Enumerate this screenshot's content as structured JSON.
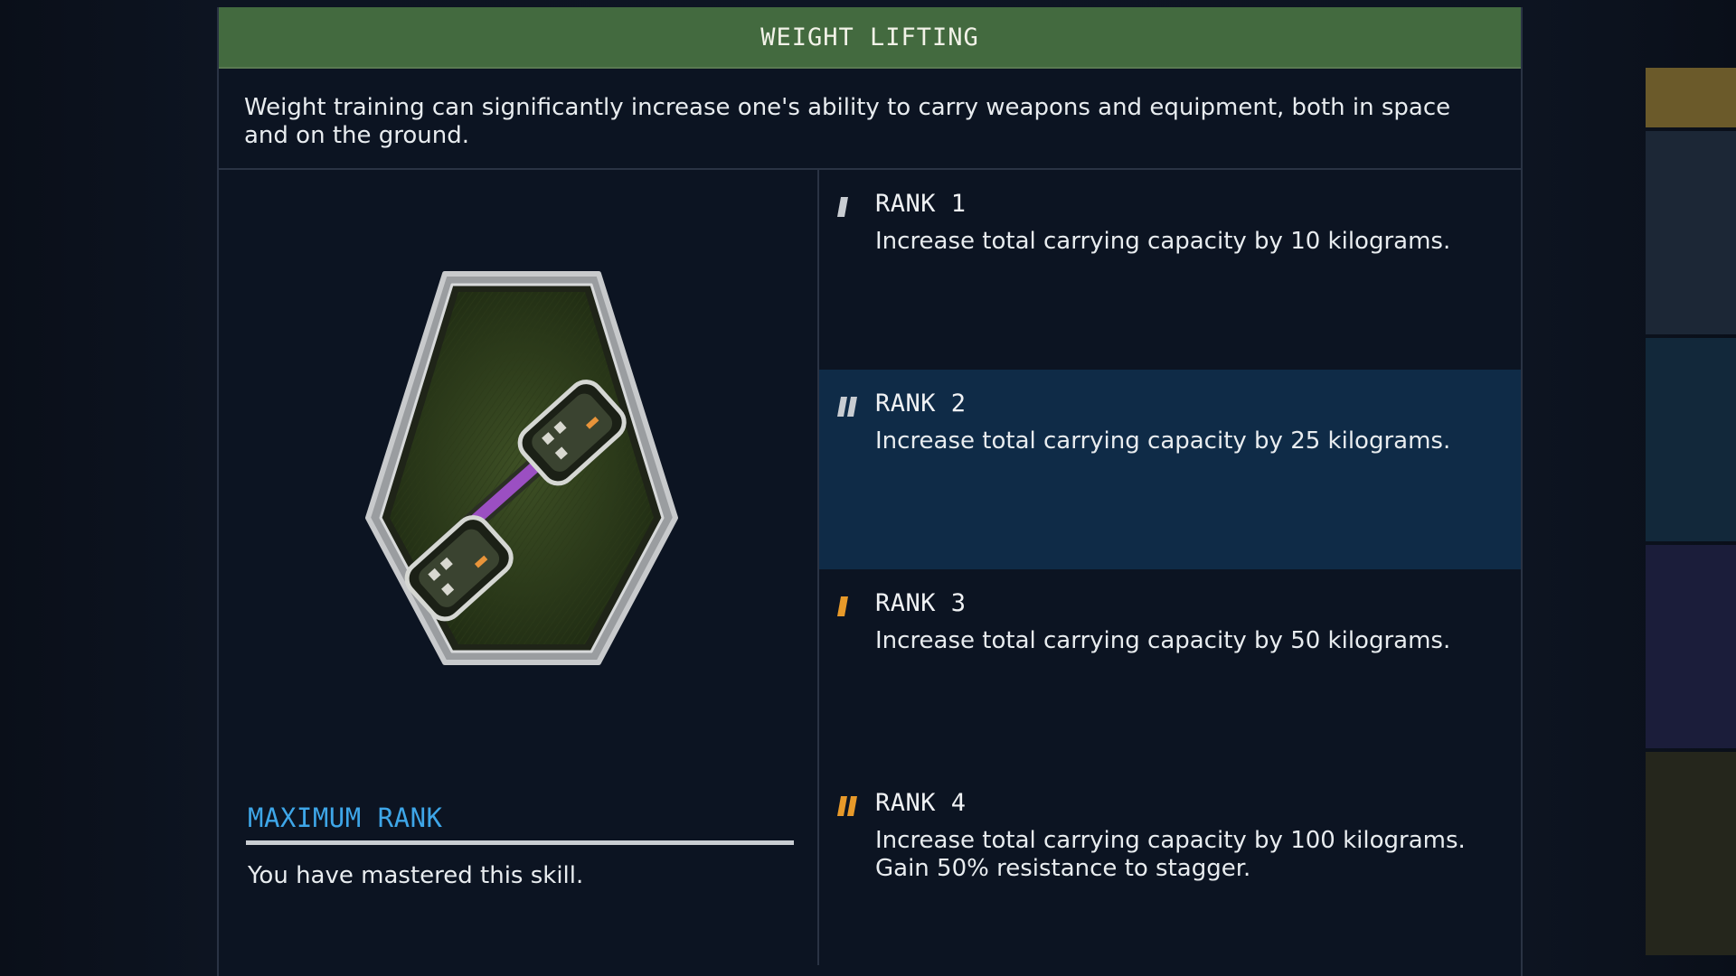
{
  "skill": {
    "title": "WEIGHT LIFTING",
    "description": "Weight training can significantly increase one's ability to carry weapons and equipment, both in space and on the ground.",
    "icon": "dumbbell-badge-icon"
  },
  "status": {
    "heading": "MAXIMUM RANK",
    "message": "You have mastered this skill."
  },
  "ranks": [
    {
      "title": "RANK 1",
      "description": "Increase total carrying capacity by 10 kilograms.",
      "marker": "single-gray",
      "selected": false
    },
    {
      "title": "RANK 2",
      "description": "Increase total carrying capacity by 25 kilograms.",
      "marker": "double-gray",
      "selected": true
    },
    {
      "title": "RANK 3",
      "description": "Increase total carrying capacity by 50 kilograms.",
      "marker": "single-orange",
      "selected": false
    },
    {
      "title": "RANK 4",
      "description": "Increase total carrying capacity by 100 kilograms. Gain 50% resistance to stagger.",
      "marker": "double-orange",
      "selected": false
    }
  ],
  "colors": {
    "title_bar": "#436a3f",
    "accent_blue": "#3ea6e8",
    "selected_row": "#0f2b47",
    "rank_marker_gray": "#c9cdd2",
    "rank_marker_orange": "#e89a2a"
  },
  "side_tabs": [
    {
      "color": "#6b5a2a"
    },
    {
      "color": "#1c2736"
    },
    {
      "color": "#12283a"
    },
    {
      "color": "#1b1d3a"
    },
    {
      "color": "#25261c"
    }
  ]
}
